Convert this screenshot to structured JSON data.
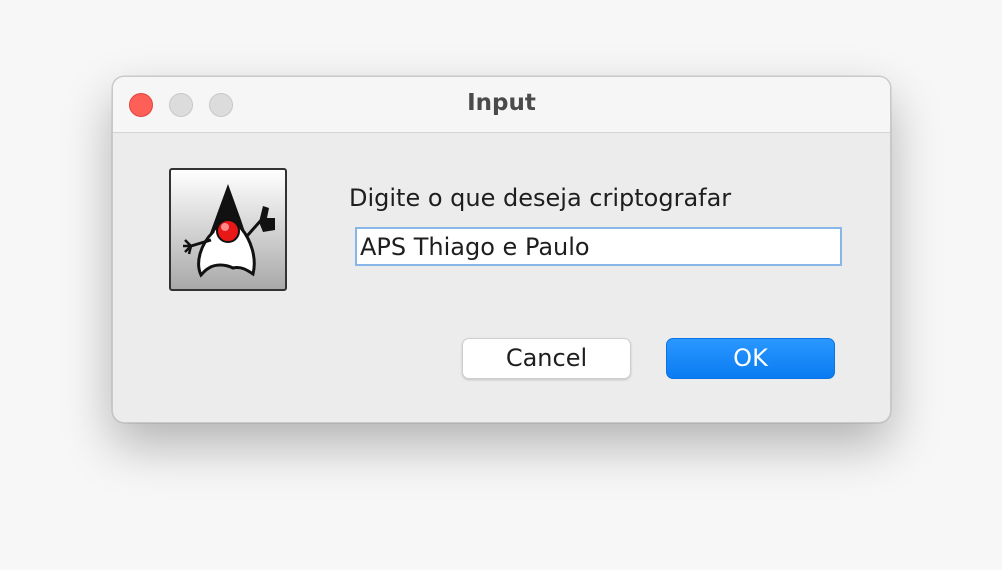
{
  "dialog": {
    "title": "Input",
    "prompt": "Digite o que deseja criptografar",
    "input_value": "APS Thiago e Paulo",
    "cancel_label": "Cancel",
    "ok_label": "OK",
    "icon": "java-duke-icon"
  },
  "colors": {
    "accent": "#0a7bf2",
    "close_button": "#fe5f57",
    "input_focus_border": "#86b7e8"
  }
}
